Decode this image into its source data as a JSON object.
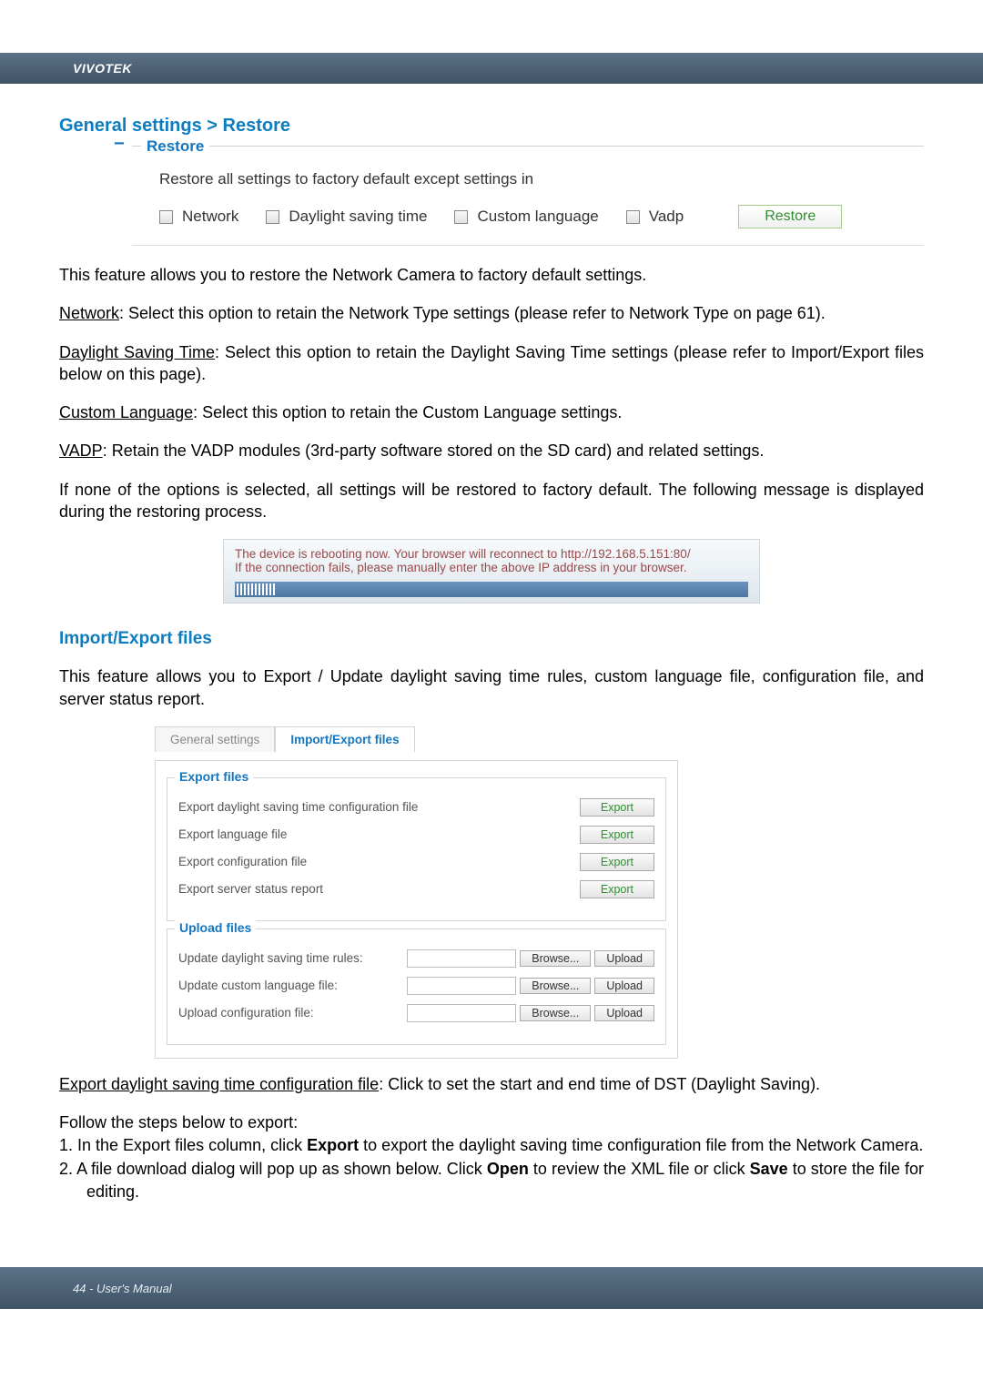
{
  "brand": "VIVOTEK",
  "section_title": "General settings > Restore",
  "restore": {
    "legend": "Restore",
    "intro": "Restore all settings to factory default except settings in",
    "options": {
      "network": "Network",
      "dst": "Daylight saving time",
      "lang": "Custom language",
      "vadp": "Vadp"
    },
    "button": "Restore"
  },
  "body": {
    "feature_intro": "This feature allows you to restore the Network Camera to factory default settings.",
    "network_label": "Network",
    "network_text": ": Select this option to retain the Network Type settings (please refer to Network Type on page 61).",
    "dst_label": "Daylight Saving Time",
    "dst_text": ": Select this option to retain the Daylight Saving Time settings (please refer to Import/Export files below on this page).",
    "lang_label": "Custom Language",
    "lang_text": ": Select this option to retain the Custom Language settings.",
    "vadp_label": "VADP",
    "vadp_text": ": Retain the VADP modules (3rd-party software stored on the SD card) and related settings.",
    "none_text": "If none of the options is selected, all settings will be restored to factory default. The following message is displayed during the restoring process."
  },
  "reboot": {
    "line1": "The device is rebooting now. Your browser will reconnect to http://192.168.5.151:80/",
    "line2": "If the connection fails, please manually enter the above IP address in your browser."
  },
  "import_export": {
    "heading": "Import/Export files",
    "intro": "This feature allows you to Export / Update daylight saving time rules, custom language file, configuration file, and server status report.",
    "tabs": {
      "general": "General settings",
      "io": "Import/Export files"
    },
    "export": {
      "legend": "Export files",
      "r1": "Export daylight saving time configuration file",
      "r2": "Export language file",
      "r3": "Export configuration file",
      "r4": "Export server status report",
      "btn": "Export"
    },
    "upload": {
      "legend": "Upload files",
      "r1": "Update daylight saving time rules:",
      "r2": "Update custom language file:",
      "r3": "Upload configuration file:",
      "browse": "Browse...",
      "upload": "Upload"
    }
  },
  "tail": {
    "exp_dst_label": "Export daylight saving time configuration file",
    "exp_dst_text": ": Click to set the start and end time of DST (Daylight Saving).",
    "follow": "Follow the steps below to export:",
    "step1_a": "1. In the Export files column, click ",
    "step1_b": "Export",
    "step1_c": " to export the daylight saving time configuration file from the Network Camera.",
    "step2_a": "2. A file download dialog will pop up as shown below. Click ",
    "step2_b": "Open",
    "step2_c": " to review the XML file or click ",
    "step2_d": "Save",
    "step2_e": " to store the file for editing."
  },
  "footer": "44 - User's Manual"
}
